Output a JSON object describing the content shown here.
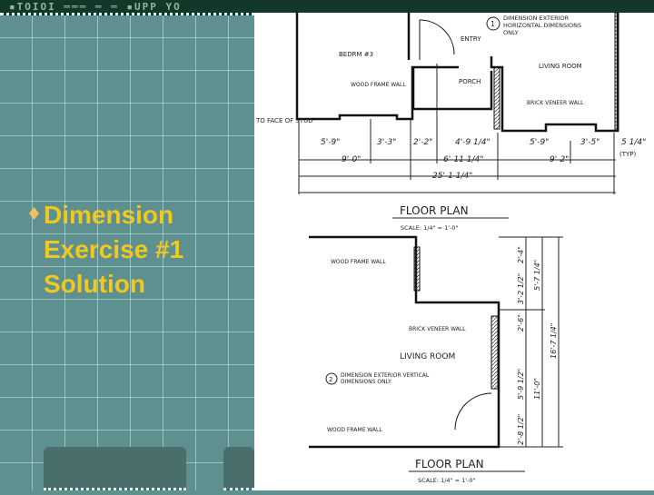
{
  "slide": {
    "bullet_lines": [
      "Dimension",
      "Exercise #1",
      "Solution"
    ],
    "colors": {
      "background": "#5f9090",
      "title_text": "#f0c820",
      "panel": "#4a6e6c"
    }
  },
  "plan_top": {
    "rooms": [
      "BEDRM #3",
      "ENTRY",
      "PORCH",
      "LIVING ROOM"
    ],
    "notes": {
      "wood": "WOOD FRAME WALL",
      "brick": "BRICK VENEER WALL",
      "face": "TO FACE OF STUD",
      "typ": "(TYP)"
    },
    "instruction_num": "1",
    "instruction": [
      "DIMENSION EXTERIOR",
      "HORIZONTAL DIMENSIONS",
      "ONLY"
    ],
    "dims_row1": [
      "5'-9\"",
      "3'-3\"",
      "2'-2\"",
      "4'-9 1/4\"",
      "5'-9\"",
      "3'-5\"",
      "5 1/4\""
    ],
    "dims_row2": [
      "9'-0\"",
      "6'-11 1/4\"",
      "9'-2\""
    ],
    "dims_total": "25'-1 1/4\""
  },
  "plan_bottom": {
    "title": "FLOOR PLAN",
    "scale": "SCALE: 1/4\" = 1'-0\"",
    "room": "LIVING ROOM",
    "notes": {
      "wood1": "WOOD FRAME WALL",
      "brick": "BRICK VENEER WALL",
      "wood2": "WOOD FRAME WALL"
    },
    "instruction_num": "2",
    "instruction": [
      "DIMENSION EXTERIOR VERTICAL",
      "DIMENSIONS ONLY"
    ],
    "dims_col1": [
      "2'-4\"",
      "3'-2 1/2\"",
      "2'-6\"",
      "5'-9 1/2\"",
      "2'-8 1/2\""
    ],
    "dims_col2": [
      "5'-7 1/4\"",
      "11'-0\""
    ],
    "dims_total": "16'-7 1/4\"",
    "title2": "FLOOR PLAN",
    "scale2": "SCALE: 1/4\" = 1'-0\""
  }
}
